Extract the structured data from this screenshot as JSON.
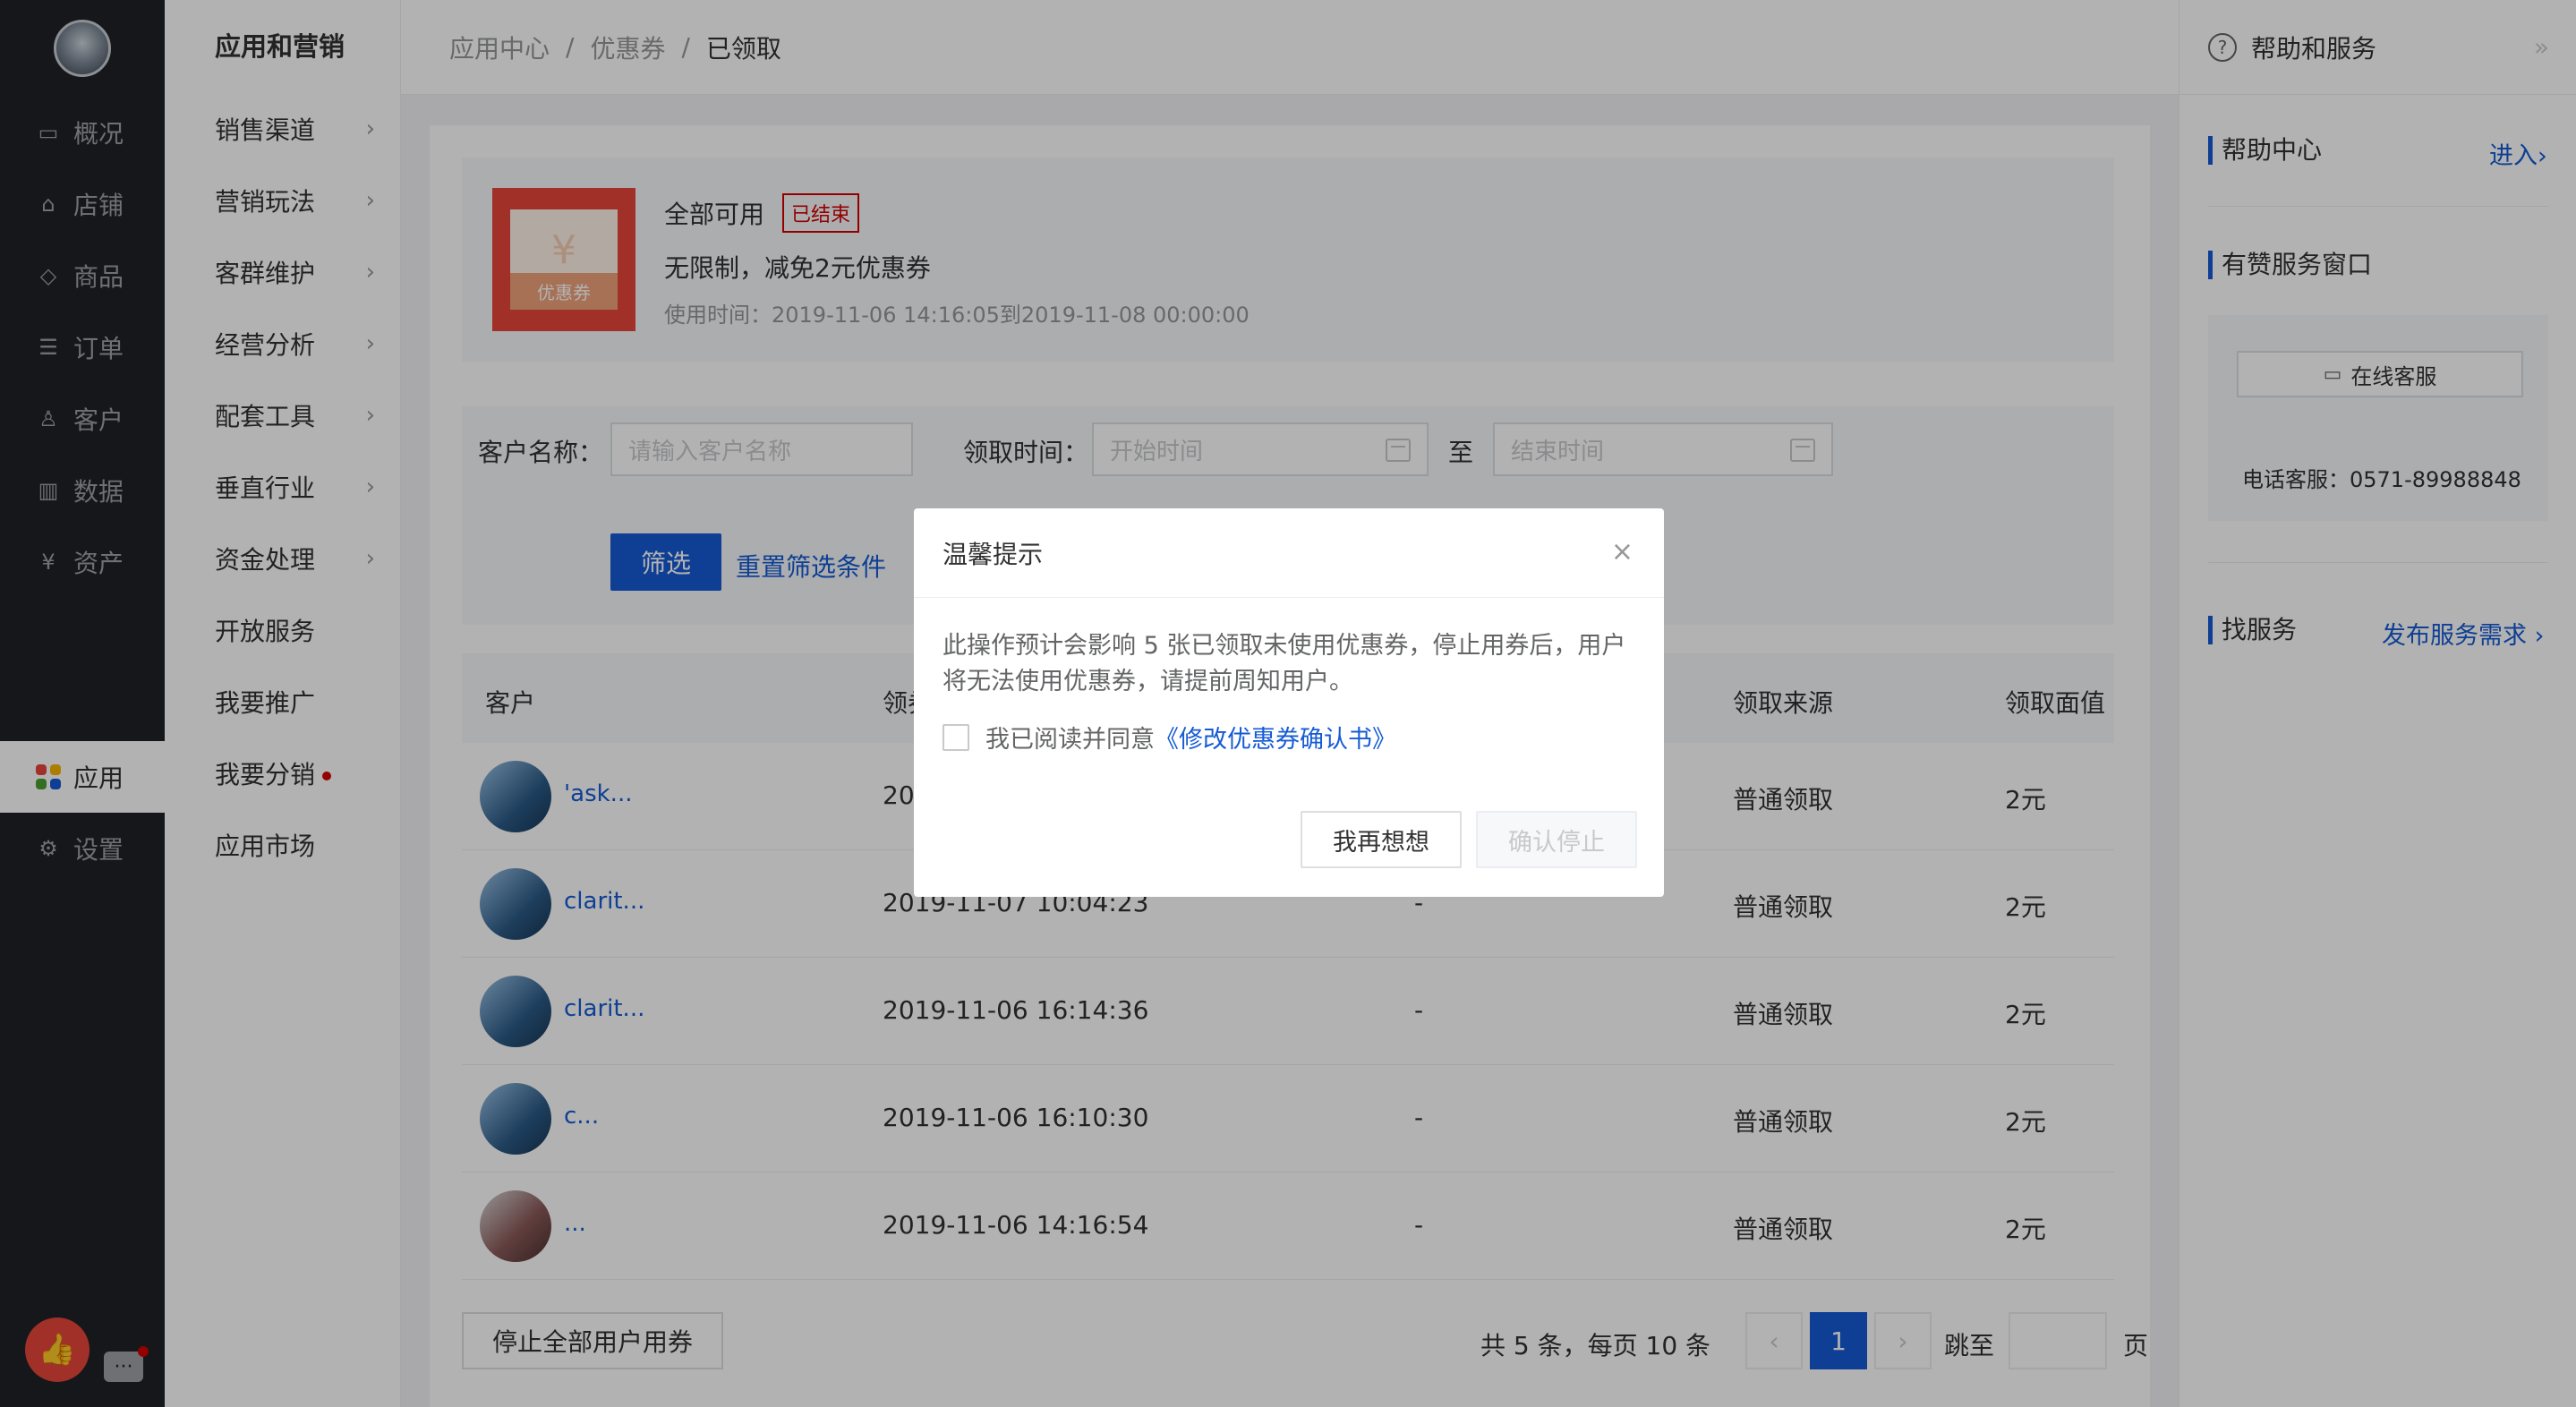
{
  "rail": {
    "items": [
      {
        "label": "概况",
        "icon": "dashboard-icon"
      },
      {
        "label": "店铺",
        "icon": "store-icon"
      },
      {
        "label": "商品",
        "icon": "tag-icon"
      },
      {
        "label": "订单",
        "icon": "order-icon"
      },
      {
        "label": "客户",
        "icon": "user-icon"
      },
      {
        "label": "数据",
        "icon": "chart-icon"
      },
      {
        "label": "资产",
        "icon": "yen-icon"
      },
      {
        "label": "应用",
        "icon": "apps-icon",
        "active": true
      },
      {
        "label": "设置",
        "icon": "gear-icon"
      }
    ],
    "apps_colors": [
      "#e6463a",
      "#f7b500",
      "#4b9e2f",
      "#155bd4"
    ]
  },
  "subnav": {
    "title": "应用和营销",
    "items": [
      {
        "label": "销售渠道",
        "arrow": true
      },
      {
        "label": "营销玩法",
        "arrow": true
      },
      {
        "label": "客群维护",
        "arrow": true
      },
      {
        "label": "经营分析",
        "arrow": true
      },
      {
        "label": "配套工具",
        "arrow": true
      },
      {
        "label": "垂直行业",
        "arrow": true
      },
      {
        "label": "资金处理",
        "arrow": true
      },
      {
        "label": "开放服务",
        "arrow": false
      },
      {
        "label": "我要推广",
        "arrow": false
      },
      {
        "label": "我要分销",
        "arrow": false,
        "dot": true
      },
      {
        "label": "应用市场",
        "arrow": false
      }
    ]
  },
  "breadcrumb": {
    "items": [
      "应用中心",
      "优惠券",
      "已领取"
    ],
    "separator": "/"
  },
  "coupon": {
    "image_label": "优惠券",
    "image_symbol": "¥",
    "title": "全部可用",
    "status_tag": "已结束",
    "description": "无限制，减免2元优惠券",
    "time_range": "使用时间：2019-11-06 14:16:05到2019-11-08 00:00:00"
  },
  "filter": {
    "customer_label": "客户名称：",
    "customer_placeholder": "请输入客户名称",
    "time_label": "领取时间：",
    "start_placeholder": "开始时间",
    "to": "至",
    "end_placeholder": "结束时间",
    "filter_button": "筛选",
    "reset_link": "重置筛选条件"
  },
  "table": {
    "headers": {
      "customer": "客户",
      "time": "领券",
      "source": "领取来源",
      "value": "领取面值"
    },
    "rows": [
      {
        "name": "'ask...",
        "time": "2019-11-07 10:04:23",
        "used": "-",
        "source": "普通领取",
        "value": "2元"
      },
      {
        "name": "clarit...",
        "time": "2019-11-07 10:04:23",
        "used": "-",
        "source": "普通领取",
        "value": "2元"
      },
      {
        "name": "clarit...",
        "time": "2019-11-06 16:14:36",
        "used": "-",
        "source": "普通领取",
        "value": "2元"
      },
      {
        "name": "c...",
        "time": "2019-11-06 16:10:30",
        "used": "-",
        "source": "普通领取",
        "value": "2元"
      },
      {
        "name": "...",
        "time": "2019-11-06 14:16:54",
        "used": "-",
        "source": "普通领取",
        "value": "2元"
      }
    ],
    "first_row_time_prefix": "201"
  },
  "footer": {
    "stop_all_button": "停止全部用户用券",
    "summary": "共 5 条，每页 10 条",
    "prev": "‹",
    "current_page": "1",
    "next": "›",
    "jump_label": "跳至",
    "page_suffix": "页"
  },
  "right_panel": {
    "title": "帮助和服务",
    "collapse": "»",
    "help_center": "帮助中心",
    "enter_link": "进入›",
    "service_window": "有赞服务窗口",
    "online_service": "在线客服",
    "phone": "电话客服：0571-89988848",
    "find_service": "找服务",
    "publish_link": "发布服务需求 ›"
  },
  "dialog": {
    "title": "温馨提示",
    "close": "×",
    "body": "此操作预计会影响 5 张已领取未使用优惠券，停止用券后，用户将无法使用优惠券，请提前周知用户。",
    "agree_prefix": "我已阅读并同意",
    "agree_link": "《修改优惠券确认书》",
    "cancel_button": "我再想想",
    "confirm_button": "确认停止"
  },
  "floating": {
    "like_icon": "thumbs-up-icon",
    "chat_icon": "chat-icon"
  }
}
